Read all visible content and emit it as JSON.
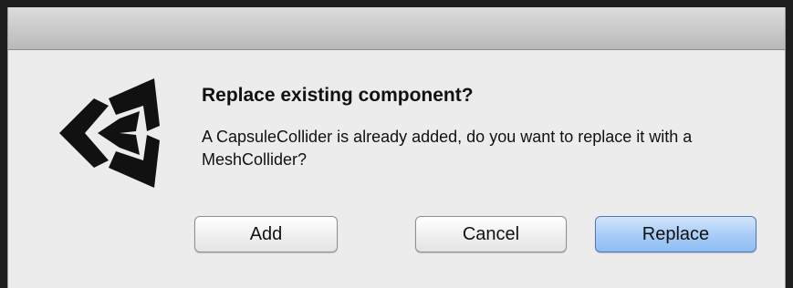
{
  "dialog": {
    "title": "Replace existing component?",
    "message": "A CapsuleCollider is already added, do you want to replace it with a MeshCollider?",
    "icon": "unity-logo-icon",
    "buttons": {
      "add": "Add",
      "cancel": "Cancel",
      "replace": "Replace"
    },
    "default_button_color": "#a9cdf6"
  }
}
